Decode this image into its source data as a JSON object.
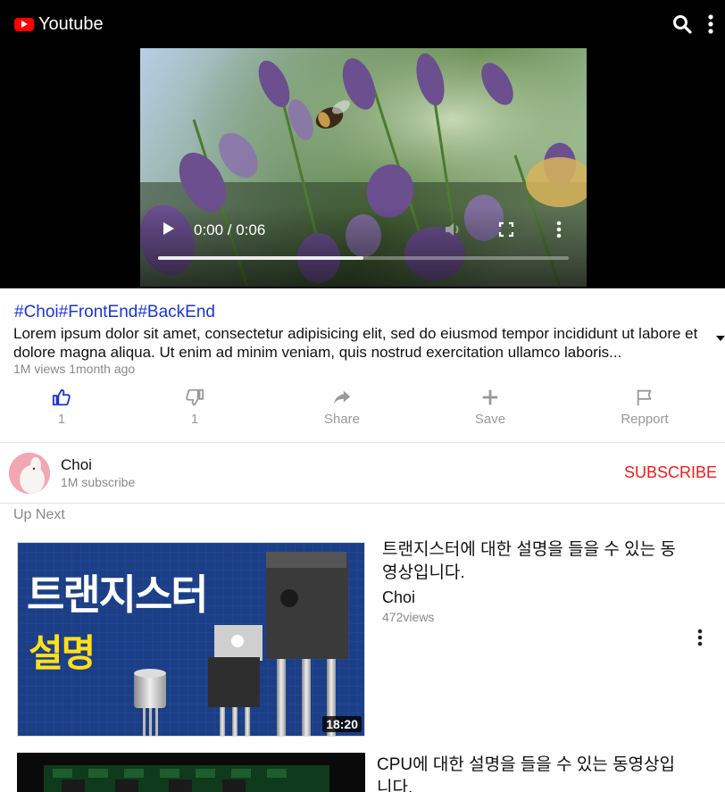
{
  "app": {
    "title": "Youtube"
  },
  "player": {
    "time": "0:00 / 0:06",
    "progress_loaded": 0.5
  },
  "video": {
    "tags": "#Choi#FrontEnd#BackEnd",
    "description": "Lorem ipsum dolor sit amet, consectetur adipisicing elit, sed do eiusmod tempor incididunt ut labore et dolore magna aliqua. Ut enim ad minim veniam, quis nostrud exercitation ullamco laboris...",
    "meta": "1M views 1month ago"
  },
  "actions": {
    "like_count": "1",
    "dislike_count": "1",
    "share": "Share",
    "save": "Save",
    "report": "Repport"
  },
  "channel": {
    "name": "Choi",
    "subscribers": "1M subscribe",
    "subscribe_label": "SUBSCRIBE"
  },
  "upnext": {
    "heading": "Up Next",
    "items": [
      {
        "title": "트랜지스터에 대한 설명을 들을 수 있는 동영상입니다.",
        "channel": "Choi",
        "views": "472views",
        "duration": "18:20",
        "thumb_text_1": "트랜지스터",
        "thumb_text_2": "설명"
      },
      {
        "title": "CPU에 대한 설명을 들을 수 있는 동영상입니다."
      }
    ]
  },
  "colors": {
    "brand": "#ff0000",
    "tags": "#1a35d6",
    "subscribe": "#ee1c1c",
    "like_active": "#1a35d6"
  }
}
